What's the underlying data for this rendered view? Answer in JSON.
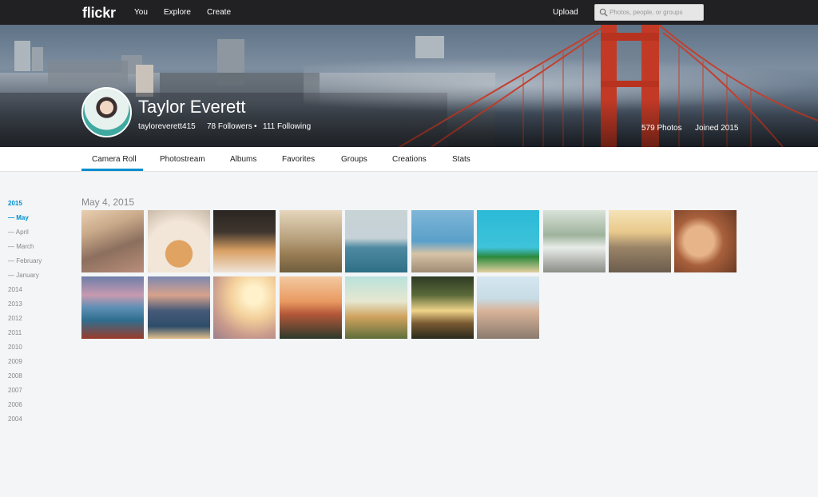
{
  "app": {
    "logo": "flickr",
    "nav": [
      "You",
      "Explore",
      "Create"
    ],
    "upload_label": "Upload",
    "search_placeholder": "Photos, people, or groups"
  },
  "profile": {
    "display_name": "Taylor Everett",
    "username": "tayloreverett415",
    "followers": "78 Followers",
    "bullet": "•",
    "following": "111 Following",
    "photos": "579 Photos",
    "joined": "Joined 2015"
  },
  "tabs": [
    "Camera Roll",
    "Photostream",
    "Albums",
    "Favorites",
    "Groups",
    "Creations",
    "Stats"
  ],
  "active_tab": "Camera Roll",
  "timeline": {
    "active_year": "2015",
    "active_month": "May",
    "months": [
      "May",
      "April",
      "March",
      "February",
      "January"
    ],
    "years": [
      "2015",
      "2014",
      "2013",
      "2012",
      "2011",
      "2010",
      "2009",
      "2008",
      "2007",
      "2006",
      "2004"
    ]
  },
  "section": {
    "date_heading": "May 4, 2015"
  },
  "colors": {
    "topbar": "#212124",
    "accent": "#008ecf",
    "page_bg": "#f3f5f6"
  },
  "photos": [
    {
      "subject": "old-street-alley"
    },
    {
      "subject": "croissants-with-coffee"
    },
    {
      "subject": "cafe-pastries"
    },
    {
      "subject": "hikers-in-field"
    },
    {
      "subject": "couple-at-lake"
    },
    {
      "subject": "person-jumping-rocks"
    },
    {
      "subject": "palm-trees-blue-sky"
    },
    {
      "subject": "vintage-van-couple"
    },
    {
      "subject": "mountain-road-sunset"
    },
    {
      "subject": "couple-kissing-cheek"
    },
    {
      "subject": "boats-on-mountain-lake"
    },
    {
      "subject": "lake-mountains-sunrise"
    },
    {
      "subject": "golden-haze-field"
    },
    {
      "subject": "palm-trees-sunset"
    },
    {
      "subject": "palm-trees-teal-sky"
    },
    {
      "subject": "redwood-forest"
    },
    {
      "subject": "group-of-friends-beach"
    }
  ]
}
